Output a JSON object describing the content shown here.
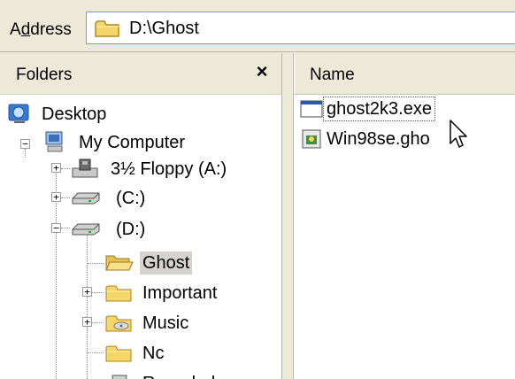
{
  "address": {
    "label_prefix": "A",
    "label_underlined": "d",
    "label_suffix": "dress",
    "value": "D:\\Ghost"
  },
  "folders": {
    "title": "Folders",
    "close_glyph": "×",
    "tree": [
      {
        "label": "Desktop",
        "icon": "desktop-icon"
      },
      {
        "label": "My Computer",
        "icon": "computer-icon",
        "expander": "−"
      },
      {
        "label": "3½ Floppy (A:)",
        "icon": "floppy-drive-icon",
        "expander": "+"
      },
      {
        "label": "(C:)",
        "icon": "hard-drive-icon",
        "expander": "+"
      },
      {
        "label": "(D:)",
        "icon": "hard-drive-icon",
        "expander": "−"
      },
      {
        "label": "Ghost",
        "icon": "open-folder-icon",
        "selected": true
      },
      {
        "label": "Important",
        "icon": "folder-icon",
        "expander": "+"
      },
      {
        "label": "Music",
        "icon": "music-folder-icon",
        "expander": "+"
      },
      {
        "label": "Nc",
        "icon": "folder-icon"
      },
      {
        "label": "Recycled",
        "icon": "recycle-bin-icon"
      }
    ]
  },
  "files": {
    "column_name": "Name",
    "items": [
      {
        "name": "ghost2k3.exe",
        "icon": "exe-file-icon",
        "focused": true
      },
      {
        "name": "Win98se.gho",
        "icon": "gho-file-icon"
      }
    ]
  },
  "colors": {
    "chrome": "#ece9d8",
    "folder_yellow": "#f6d66b",
    "selection_gray": "#d6d3ce"
  }
}
